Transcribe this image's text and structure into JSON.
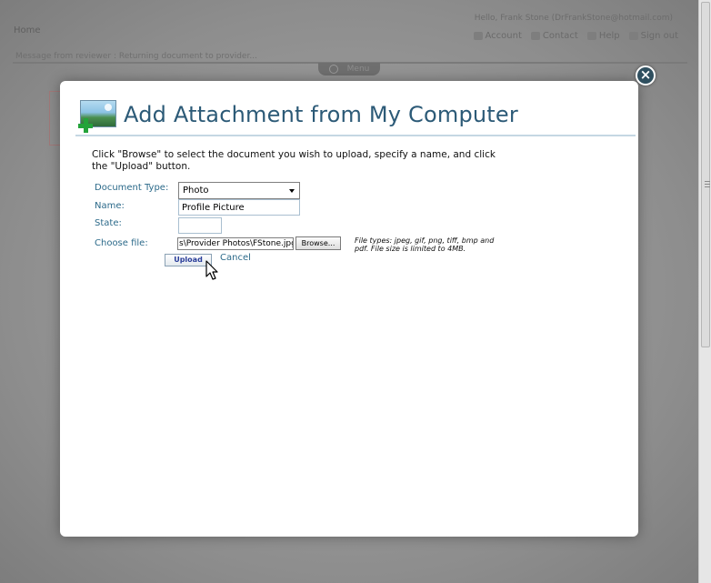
{
  "background": {
    "greeting": "Hello, Frank Stone (DrFrankStone@hotmail.com)",
    "home_label": "Home",
    "nav": [
      {
        "label": "Account",
        "icon": "account-icon"
      },
      {
        "label": "Contact",
        "icon": "contact-icon"
      },
      {
        "label": "Help",
        "icon": "help-icon"
      },
      {
        "label": "Sign out",
        "icon": "user-icon"
      }
    ],
    "message": "Message from reviewer : Returning document to provider...",
    "menu_label": "Menu"
  },
  "modal": {
    "title": "Add Attachment from My Computer",
    "close_label": "×",
    "instructions": "Click \"Browse\" to select the document you wish to upload, specify a name, and click the \"Upload\" button.",
    "form": {
      "document_type_label": "Document Type:",
      "document_type_value": "Photo",
      "name_label": "Name:",
      "name_value": "Profile Picture",
      "state_label": "State:",
      "state_value": "",
      "choose_file_label": "Choose file:",
      "file_path_value": "s\\Provider Photos\\FStone.jpg",
      "browse_label": "Browse...",
      "file_note": "File types: jpeg, gif, png, tiff, bmp and pdf. File size is limited to 4MB."
    },
    "actions": {
      "upload_label": "Upload",
      "cancel_label": "Cancel"
    }
  },
  "colors": {
    "title": "#2c5a77",
    "label": "#2c6a8a",
    "overlay": "#9a9a9a",
    "close_button": "#2f4f5f"
  }
}
